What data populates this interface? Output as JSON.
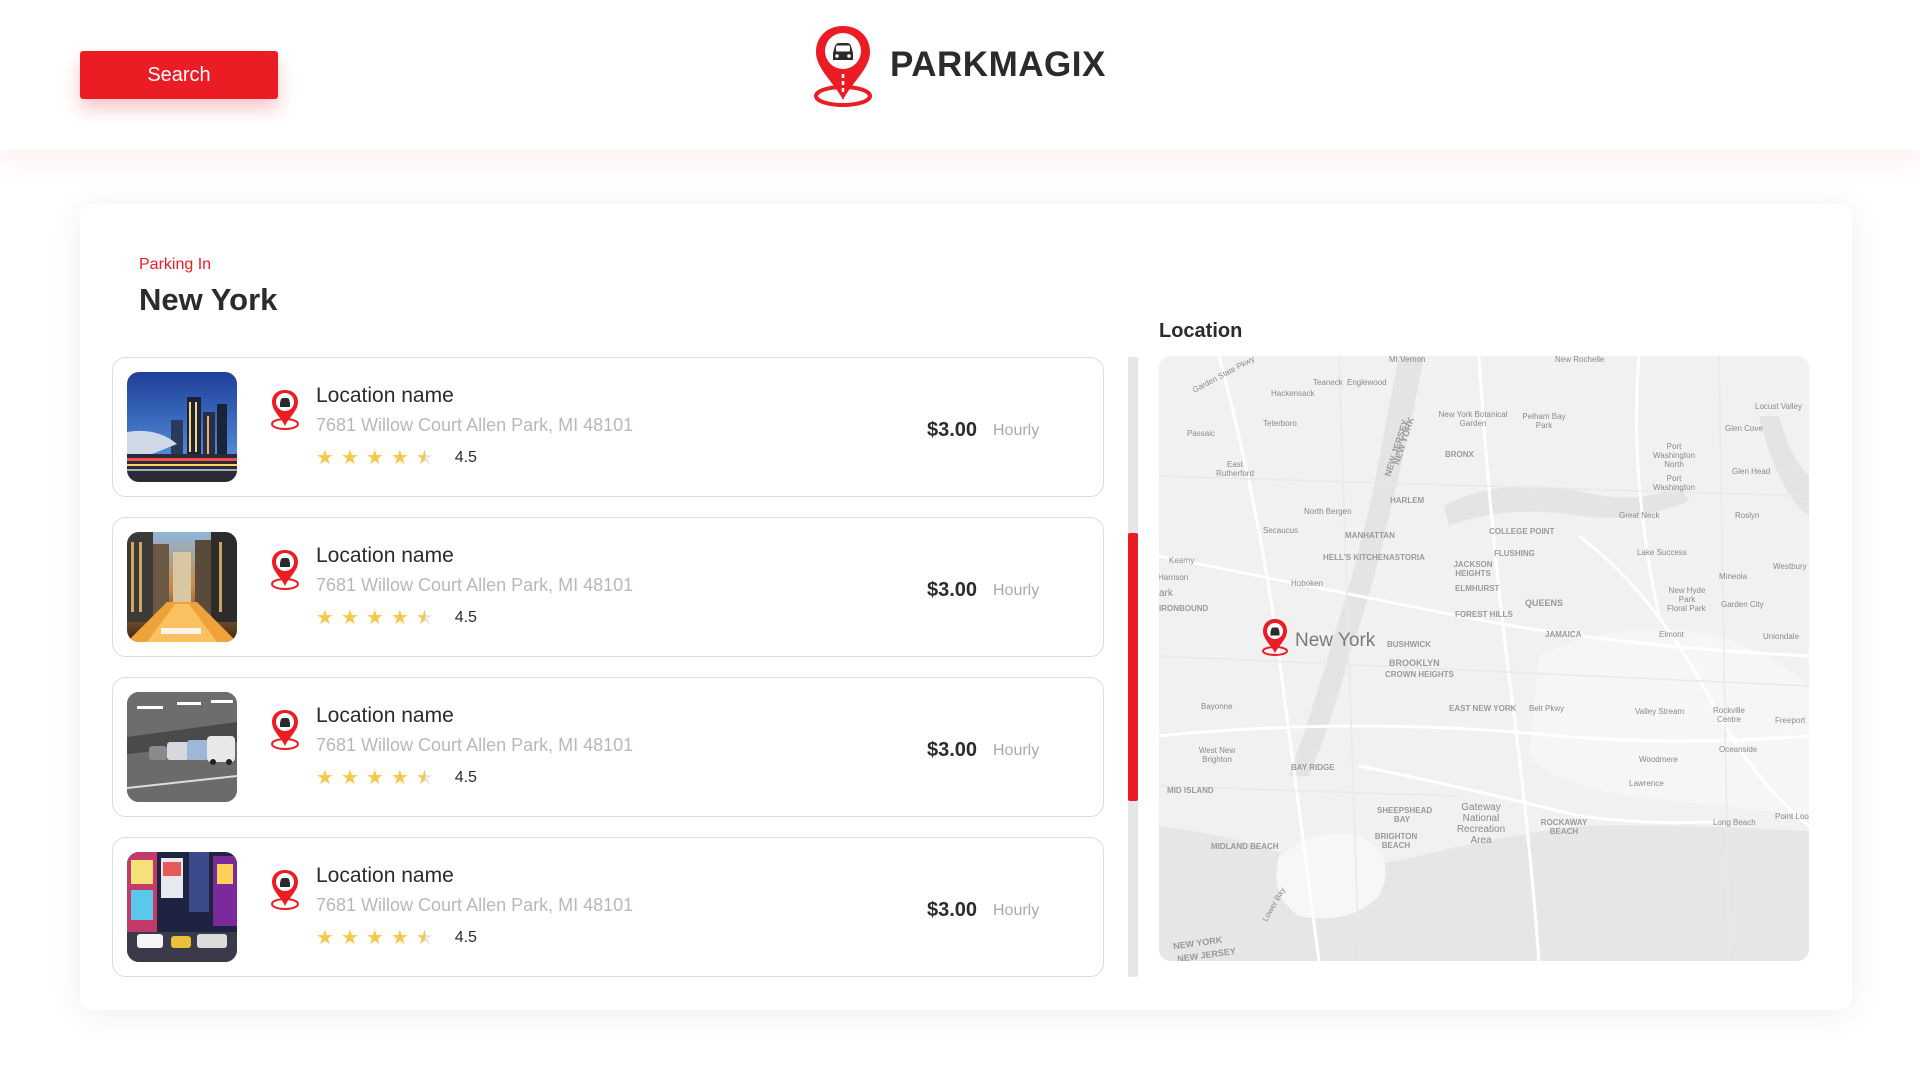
{
  "header": {
    "search_label": "Search",
    "brand": "PARKMAGIX"
  },
  "panel": {
    "kicker": "Parking In",
    "city": "New York",
    "map_title": "Location"
  },
  "listings": [
    {
      "name": "Location name",
      "address": "7681 Willow Court Allen Park, MI 48101",
      "rating": "4.5",
      "stars": 4.5,
      "price": "$3.00",
      "unit": "Hourly",
      "image": "city-night-skyline"
    },
    {
      "name": "Location name",
      "address": "7681 Willow Court Allen Park, MI 48101",
      "rating": "4.5",
      "stars": 4.5,
      "price": "$3.00",
      "unit": "Hourly",
      "image": "city-street-dusk"
    },
    {
      "name": "Location name",
      "address": "7681 Willow Court Allen Park, MI 48101",
      "rating": "4.5",
      "stars": 4.5,
      "price": "$3.00",
      "unit": "Hourly",
      "image": "parking-garage"
    },
    {
      "name": "Location name",
      "address": "7681 Willow Court Allen Park, MI 48101",
      "rating": "4.5",
      "stars": 4.5,
      "price": "$3.00",
      "unit": "Hourly",
      "image": "times-square"
    }
  ],
  "map": {
    "pin_label": "New York",
    "labels": [
      "Mt Vernon",
      "New Rochelle",
      "Teaneck",
      "Englewood",
      "Hackensack",
      "Garden State Pkwy",
      "Teterboro",
      "New York Botanical Garden",
      "Pelham Bay Park",
      "Locust Valley",
      "Glen Cove",
      "Passaic",
      "East Rutherford",
      "BRONX",
      "Port Washington North",
      "Port Washington",
      "Glen Head",
      "NEW JERSEY",
      "NEW YORK",
      "HARLEM",
      "North Bergen",
      "Great Neck",
      "Roslyn",
      "Secaucus",
      "MANHATTAN",
      "COLLEGE POINT",
      "Kearny",
      "HELL'S KITCHEN",
      "ASTORIA",
      "FLUSHING",
      "Lake Success",
      "Harrison",
      "JACKSON HEIGHTS",
      "Hoboken",
      "ELMHURST",
      "Mineola",
      "Westbury",
      "ark",
      "New Hyde Park",
      "Floral Park",
      "Garden City",
      "IRONBOUND",
      "FOREST HILLS",
      "QUEENS",
      "JAMAICA",
      "Elmont",
      "Uniondale",
      "BUSHWICK",
      "BROOKLYN",
      "CROWN HEIGHTS",
      "Bayonne",
      "EAST NEW YORK",
      "Belt Pkwy",
      "Valley Stream",
      "Rockville Centre",
      "Freeport",
      "West New Brighton",
      "Oceanside",
      "BAY RIDGE",
      "Woodmere",
      "Lawrence",
      "MID ISLAND",
      "SHEEPSHEAD BAY",
      "Gateway National Recreation Area",
      "ROCKAWAY BEACH",
      "Long Beach",
      "Point Lookout",
      "BRIGHTON BEACH",
      "MIDLAND BEACH",
      "Lower Bay",
      "NEW YORK",
      "NEW JERSEY"
    ]
  },
  "colors": {
    "accent": "#ec1c24",
    "text": "#2b2b2b",
    "muted": "#b8b8b8",
    "star": "#f4c84a",
    "map_bg": "#f1f1f1"
  }
}
